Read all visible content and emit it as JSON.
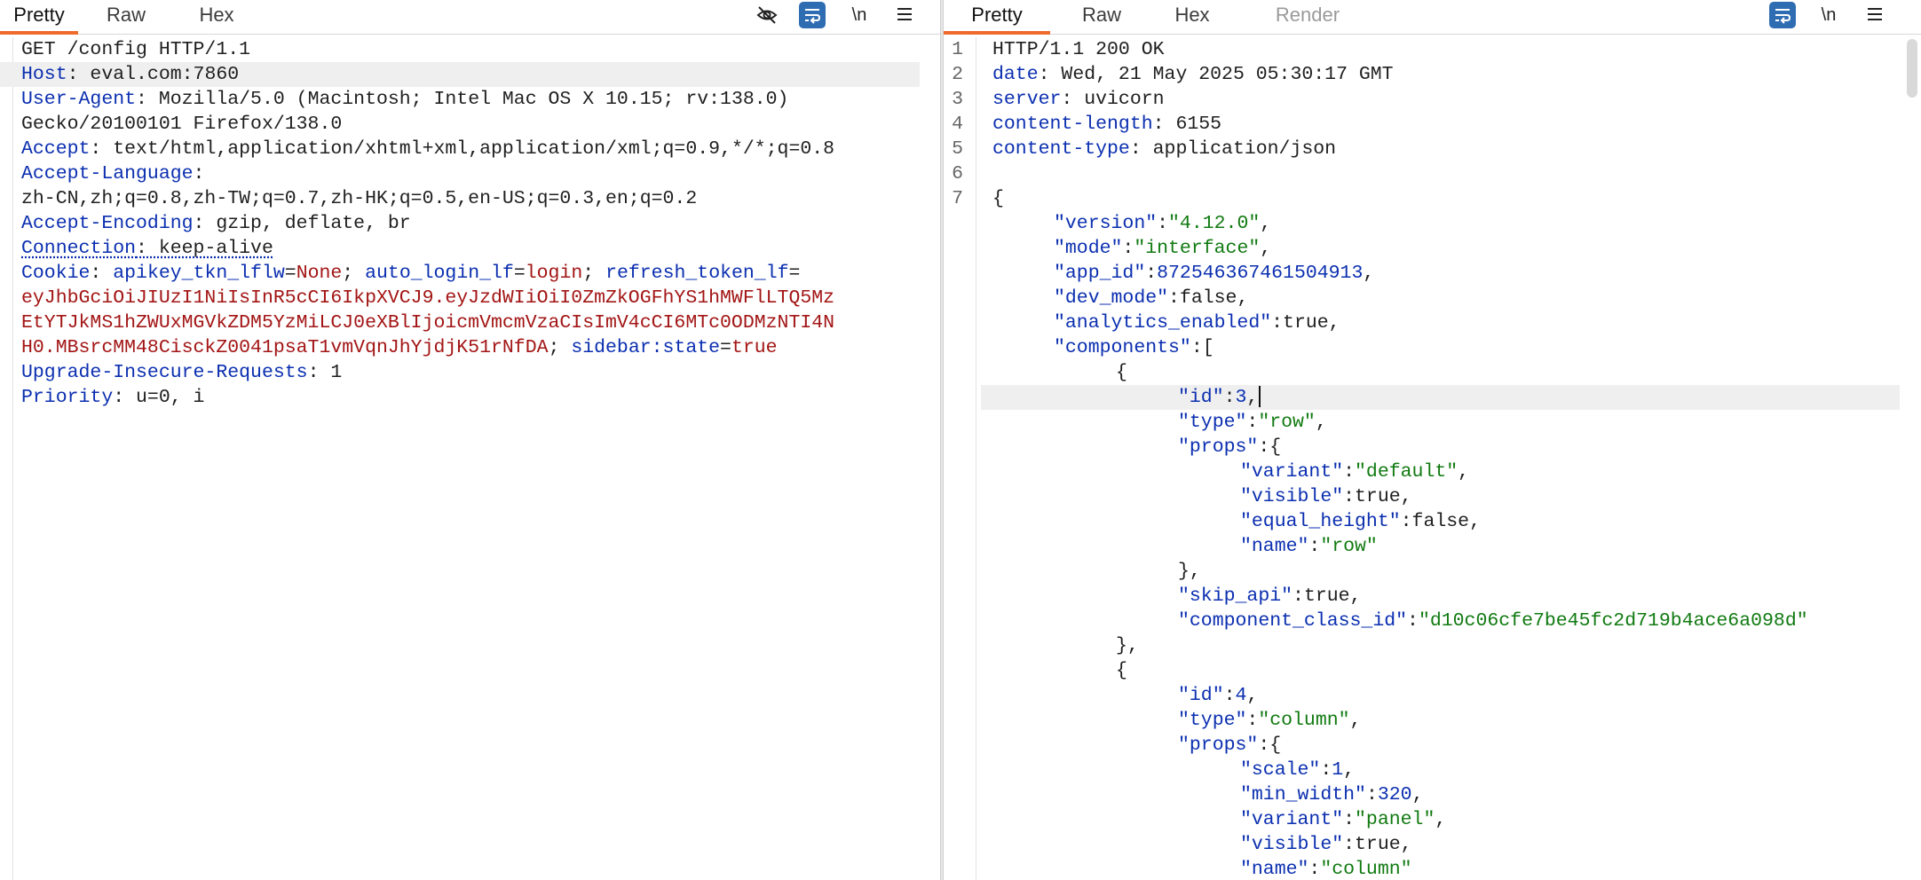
{
  "left": {
    "tabs": [
      "Pretty",
      "Raw",
      "Hex"
    ],
    "tools": {
      "hide_icon": "eye-slash-icon",
      "wrap_icon": "wrap-lines-icon",
      "newline_label": "\\n",
      "menu_icon": "hamburger-menu-icon"
    },
    "lines": {
      "l1": "GET /config HTTP/1.1",
      "l2_key": "Host",
      "l2_val": " eval.com:7860",
      "l3_key": "User-Agent",
      "l3_val": " Mozilla/5.0 (Macintosh; Intel Mac OS X 10.15; rv:138.0)",
      "l3b": "Gecko/20100101 Firefox/138.0",
      "l4_key": "Accept",
      "l4_val": " text/html,application/xhtml+xml,application/xml;q=0.9,*/*;q=0.8",
      "l5_key": "Accept-Language",
      "l5_val": ":",
      "l5b": "zh-CN,zh;q=0.8,zh-TW;q=0.7,zh-HK;q=0.5,en-US;q=0.3,en;q=0.2",
      "l6_key": "Accept-Encoding",
      "l6_val": " gzip, deflate, br",
      "l7_key": "Connection",
      "l7_val": " keep-alive",
      "l8_key": "Cookie",
      "l8_c1k": "apikey_tkn_lflw",
      "l8_c1v": "None",
      "l8_c2k": "auto_login_lf",
      "l8_c2v": "login",
      "l8_c3k": "refresh_token_lf",
      "l8b": "eyJhbGciOiJIUzI1NiIsInR5cCI6IkpXVCJ9.eyJzdWIiOiI0ZmZkOGFhYS1hMWFlLTQ5Mz",
      "l8c": "EtYTJkMS1hZWUxMGVkZDM5YzMiLCJ0eXBlIjoicmVmcmVzaCIsImV4cCI6MTc0ODMzNTI4N",
      "l8d_tok": "H0.MBsrcMM48CisckZ0041psaT1vmVqnJhYjdjK51rNfDA",
      "l8d_k": "sidebar:state",
      "l8d_v": "true",
      "l9_key": "Upgrade-Insecure-Requests",
      "l9_val": " 1",
      "l10_key": "Priority",
      "l10_val": " u=0, i"
    }
  },
  "right": {
    "tabs": [
      "Pretty",
      "Raw",
      "Hex",
      "Render"
    ],
    "tools": {
      "wrap_icon": "wrap-lines-icon",
      "newline_label": "\\n",
      "menu_icon": "hamburger-menu-icon"
    },
    "line_numbers": [
      "1",
      "2",
      "3",
      "4",
      "5",
      "6",
      "7"
    ],
    "lines": {
      "r1": "HTTP/1.1 200 OK",
      "r2_key": "date",
      "r2_val": " Wed, 21 May 2025 05:30:17 GMT",
      "r3_key": "server",
      "r3_val": " uvicorn",
      "r4_key": "content-length",
      "r4_val": " 6155",
      "r5_key": "content-type",
      "r5_val": " application/json",
      "r7": "{",
      "version_k": "\"version\"",
      "version_v": "\"4.12.0\"",
      "mode_k": "\"mode\"",
      "mode_v": "\"interface\"",
      "appid_k": "\"app_id\"",
      "appid_v": "872546367461504913",
      "devmode_k": "\"dev_mode\"",
      "devmode_v": "false",
      "analytics_k": "\"analytics_enabled\"",
      "analytics_v": "true",
      "components_k": "\"components\"",
      "id1_k": "\"id\"",
      "id1_v": "3",
      "type1_k": "\"type\"",
      "type1_v": "\"row\"",
      "props_k": "\"props\"",
      "variant1_k": "\"variant\"",
      "variant1_v": "\"default\"",
      "visible1_k": "\"visible\"",
      "visible1_v": "true",
      "eqh_k": "\"equal_height\"",
      "eqh_v": "false",
      "name1_k": "\"name\"",
      "name1_v": "\"row\"",
      "skip_k": "\"skip_api\"",
      "skip_v": "true",
      "ccid_k": "\"component_class_id\"",
      "ccid_v": "\"d10c06cfe7be45fc2d719b4ace6a098d\"",
      "id2_k": "\"id\"",
      "id2_v": "4",
      "type2_k": "\"type\"",
      "type2_v": "\"column\"",
      "scale_k": "\"scale\"",
      "scale_v": "1",
      "minw_k": "\"min_width\"",
      "minw_v": "320",
      "variant2_k": "\"variant\"",
      "variant2_v": "\"panel\"",
      "visible2_k": "\"visible\"",
      "visible2_v": "true",
      "name2_k": "\"name\"",
      "name2_v": "\"column\""
    }
  }
}
